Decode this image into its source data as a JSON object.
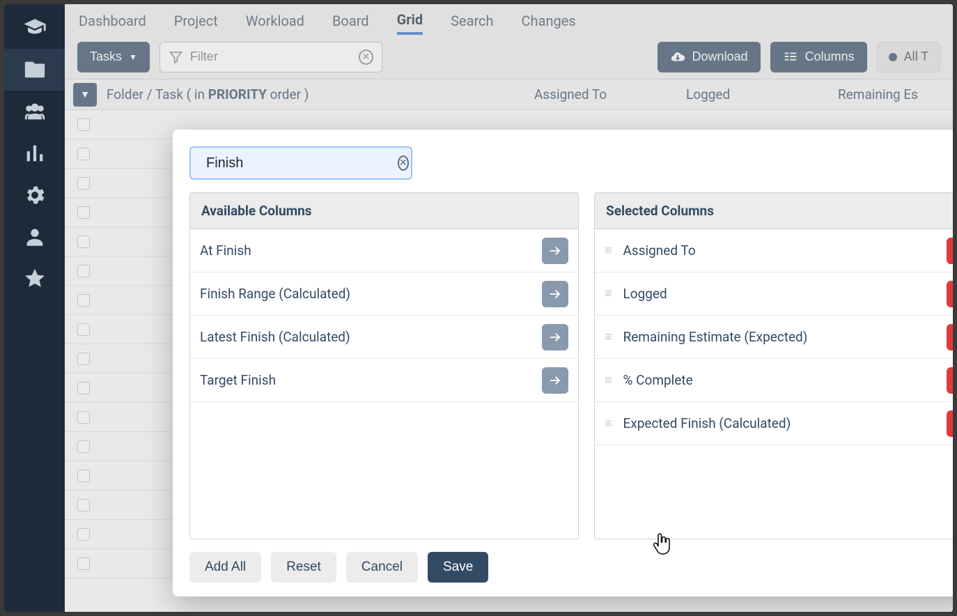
{
  "sidebar": {
    "items": [
      {
        "name": "education-icon"
      },
      {
        "name": "folder-icon",
        "active": true
      },
      {
        "name": "people-icon"
      },
      {
        "name": "chart-icon"
      },
      {
        "name": "gear-icon"
      },
      {
        "name": "user-icon"
      },
      {
        "name": "star-icon"
      }
    ]
  },
  "topnav": {
    "tabs": [
      "Dashboard",
      "Project",
      "Workload",
      "Board",
      "Grid",
      "Search",
      "Changes"
    ],
    "active": "Grid"
  },
  "toolbar": {
    "tasks_label": "Tasks",
    "filter_placeholder": "Filter",
    "download_label": "Download",
    "columns_label": "Columns",
    "status_label": "All T"
  },
  "grid": {
    "header_main_prefix": "Folder / Task  ( in ",
    "header_main_bold": "PRIORITY",
    "header_main_suffix": " order )",
    "header_assigned": "Assigned To",
    "header_logged": "Logged",
    "header_remaining": "Remaining Es"
  },
  "modal": {
    "search_value": "Finish",
    "available_header": "Available Columns",
    "selected_header": "Selected Columns",
    "available": [
      "At Finish",
      "Finish Range (Calculated)",
      "Latest Finish (Calculated)",
      "Target Finish"
    ],
    "selected": [
      "Assigned To",
      "Logged",
      "Remaining Estimate (Expected)",
      "% Complete",
      "Expected Finish (Calculated)"
    ],
    "buttons": {
      "add_all": "Add All",
      "reset": "Reset",
      "cancel": "Cancel",
      "save": "Save"
    }
  }
}
